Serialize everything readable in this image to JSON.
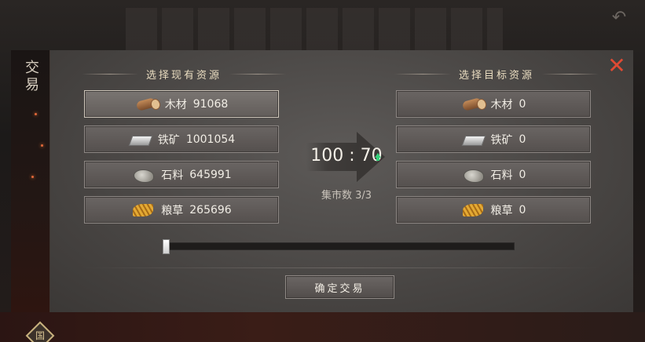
{
  "sidebar": {
    "title": "交易",
    "seal_glyph": "国"
  },
  "panel": {
    "left_title": "选择现有资源",
    "right_title": "选择目标资源",
    "close_glyph": "✕"
  },
  "owned_resources": [
    {
      "name": "木材",
      "amount": "91068",
      "icon": "wood-icon",
      "selected": true
    },
    {
      "name": "铁矿",
      "amount": "1001054",
      "icon": "iron-icon"
    },
    {
      "name": "石料",
      "amount": "645991",
      "icon": "stone-icon"
    },
    {
      "name": "粮草",
      "amount": "265696",
      "icon": "grain-icon"
    }
  ],
  "target_resources": [
    {
      "name": "木材",
      "amount": "0",
      "icon": "wood-icon"
    },
    {
      "name": "铁矿",
      "amount": "0",
      "icon": "iron-icon"
    },
    {
      "name": "石料",
      "amount": "0",
      "icon": "stone-icon"
    },
    {
      "name": "粮草",
      "amount": "0",
      "icon": "grain-icon"
    }
  ],
  "exchange": {
    "ratio": "100 : 70",
    "ratio_trend": "up",
    "market_count": "集市数 3/3",
    "slider_value": 0
  },
  "confirm_label": "确定交易",
  "colors": {
    "close": "#e04a33",
    "trend_up": "#36d07a",
    "title": "#e9dcc0"
  }
}
